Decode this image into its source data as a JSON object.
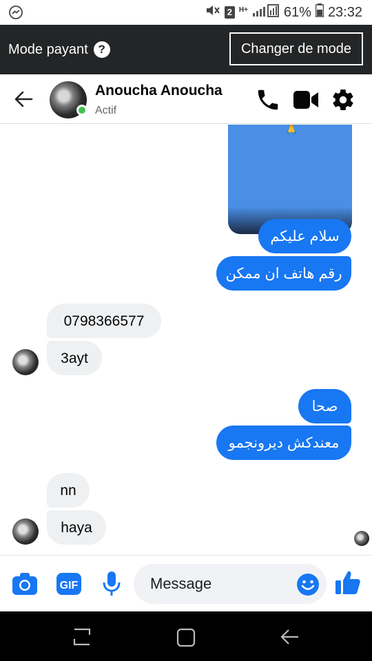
{
  "status_bar": {
    "sim_badge": "2",
    "network": "H+",
    "battery_percent": "61%",
    "time": "23:32"
  },
  "mode_bar": {
    "label": "Mode payant",
    "help_glyph": "?",
    "change_button": "Changer de mode"
  },
  "chat_header": {
    "contact_name": "Anoucha Anoucha",
    "status": "Actif"
  },
  "messages": [
    {
      "side": "out",
      "text": "سلام عليكم"
    },
    {
      "side": "out",
      "text": "رقم هاتف ان ممكن"
    },
    {
      "side": "in",
      "text": "0798366577"
    },
    {
      "side": "in",
      "text": "3ayt"
    },
    {
      "side": "out",
      "text": "صحا"
    },
    {
      "side": "out",
      "text": "معندكش ديرونجمو"
    },
    {
      "side": "in",
      "text": "nn"
    },
    {
      "side": "in",
      "text": "haya"
    }
  ],
  "media_emoji": "🙏",
  "composer": {
    "gif_label": "GIF",
    "placeholder": "Message"
  },
  "colors": {
    "accent": "#1877f2",
    "online": "#44c14d",
    "dark_bar": "#242526",
    "incoming_bubble": "#eef0f2"
  },
  "icons": [
    "messenger-icon",
    "mute-icon",
    "signal-icon",
    "battery-icon",
    "help-icon",
    "back-arrow-icon",
    "phone-icon",
    "video-icon",
    "gear-icon",
    "camera-icon",
    "gif-icon",
    "microphone-icon",
    "emoji-icon",
    "thumbs-up-icon",
    "recents-icon",
    "home-icon",
    "back-nav-icon"
  ]
}
